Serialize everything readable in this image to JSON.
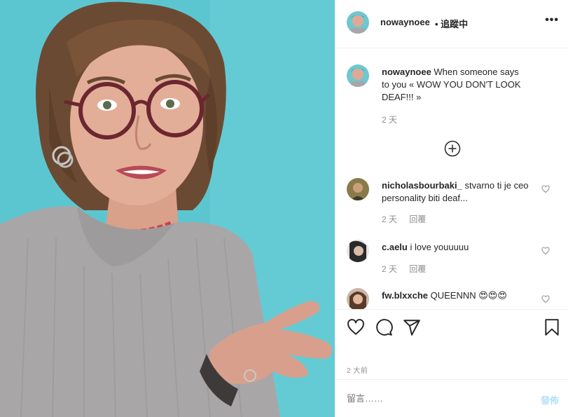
{
  "post": {
    "username": "nowaynoee",
    "follow_status": "• 追蹤中",
    "more_icon": "more-horizontal-icon",
    "caption": {
      "username": "nowaynoee",
      "text": " When someone says to you « WOW YOU DON'T LOOK DEAF!!! »",
      "time": "2 天"
    }
  },
  "comments": [
    {
      "username": "nicholasbourbaki_",
      "text": " stvarno ti je ceo personality biti deaf...",
      "time": "2 天",
      "reply": "回覆"
    },
    {
      "username": "c.aelu",
      "text": " i love youuuuu",
      "time": "2 天",
      "reply": "回覆"
    },
    {
      "username": "fw.blxxche",
      "text": " QUEENNN 😍😍😍"
    }
  ],
  "actions": {
    "icons": [
      "heart-icon",
      "comment-icon",
      "share-icon",
      "bookmark-icon"
    ],
    "timestamp": "2 大前"
  },
  "composer": {
    "placeholder": "留言……",
    "post_label": "發佈"
  },
  "colors": {
    "photo_bg": "#5fc4cf",
    "post_link_disabled": "#b2dffc",
    "secondary_text": "#8e8e8e"
  }
}
